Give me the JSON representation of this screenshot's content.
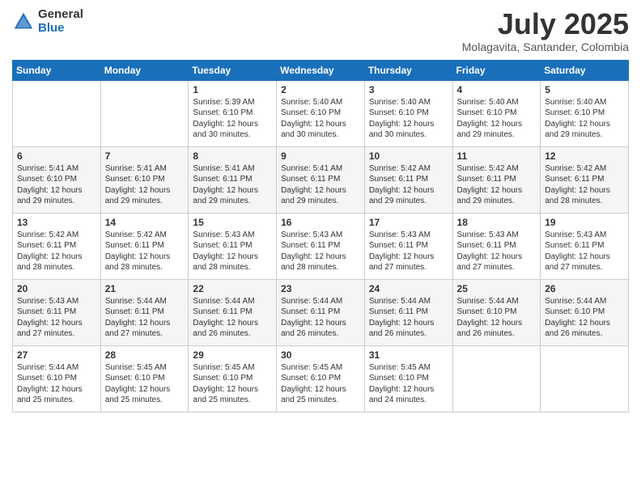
{
  "logo": {
    "general": "General",
    "blue": "Blue"
  },
  "title": "July 2025",
  "location": "Molagavita, Santander, Colombia",
  "days_of_week": [
    "Sunday",
    "Monday",
    "Tuesday",
    "Wednesday",
    "Thursday",
    "Friday",
    "Saturday"
  ],
  "weeks": [
    [
      {
        "day": "",
        "info": ""
      },
      {
        "day": "",
        "info": ""
      },
      {
        "day": "1",
        "info": "Sunrise: 5:39 AM\nSunset: 6:10 PM\nDaylight: 12 hours and 30 minutes."
      },
      {
        "day": "2",
        "info": "Sunrise: 5:40 AM\nSunset: 6:10 PM\nDaylight: 12 hours and 30 minutes."
      },
      {
        "day": "3",
        "info": "Sunrise: 5:40 AM\nSunset: 6:10 PM\nDaylight: 12 hours and 30 minutes."
      },
      {
        "day": "4",
        "info": "Sunrise: 5:40 AM\nSunset: 6:10 PM\nDaylight: 12 hours and 29 minutes."
      },
      {
        "day": "5",
        "info": "Sunrise: 5:40 AM\nSunset: 6:10 PM\nDaylight: 12 hours and 29 minutes."
      }
    ],
    [
      {
        "day": "6",
        "info": "Sunrise: 5:41 AM\nSunset: 6:10 PM\nDaylight: 12 hours and 29 minutes."
      },
      {
        "day": "7",
        "info": "Sunrise: 5:41 AM\nSunset: 6:10 PM\nDaylight: 12 hours and 29 minutes."
      },
      {
        "day": "8",
        "info": "Sunrise: 5:41 AM\nSunset: 6:11 PM\nDaylight: 12 hours and 29 minutes."
      },
      {
        "day": "9",
        "info": "Sunrise: 5:41 AM\nSunset: 6:11 PM\nDaylight: 12 hours and 29 minutes."
      },
      {
        "day": "10",
        "info": "Sunrise: 5:42 AM\nSunset: 6:11 PM\nDaylight: 12 hours and 29 minutes."
      },
      {
        "day": "11",
        "info": "Sunrise: 5:42 AM\nSunset: 6:11 PM\nDaylight: 12 hours and 29 minutes."
      },
      {
        "day": "12",
        "info": "Sunrise: 5:42 AM\nSunset: 6:11 PM\nDaylight: 12 hours and 28 minutes."
      }
    ],
    [
      {
        "day": "13",
        "info": "Sunrise: 5:42 AM\nSunset: 6:11 PM\nDaylight: 12 hours and 28 minutes."
      },
      {
        "day": "14",
        "info": "Sunrise: 5:42 AM\nSunset: 6:11 PM\nDaylight: 12 hours and 28 minutes."
      },
      {
        "day": "15",
        "info": "Sunrise: 5:43 AM\nSunset: 6:11 PM\nDaylight: 12 hours and 28 minutes."
      },
      {
        "day": "16",
        "info": "Sunrise: 5:43 AM\nSunset: 6:11 PM\nDaylight: 12 hours and 28 minutes."
      },
      {
        "day": "17",
        "info": "Sunrise: 5:43 AM\nSunset: 6:11 PM\nDaylight: 12 hours and 27 minutes."
      },
      {
        "day": "18",
        "info": "Sunrise: 5:43 AM\nSunset: 6:11 PM\nDaylight: 12 hours and 27 minutes."
      },
      {
        "day": "19",
        "info": "Sunrise: 5:43 AM\nSunset: 6:11 PM\nDaylight: 12 hours and 27 minutes."
      }
    ],
    [
      {
        "day": "20",
        "info": "Sunrise: 5:43 AM\nSunset: 6:11 PM\nDaylight: 12 hours and 27 minutes."
      },
      {
        "day": "21",
        "info": "Sunrise: 5:44 AM\nSunset: 6:11 PM\nDaylight: 12 hours and 27 minutes."
      },
      {
        "day": "22",
        "info": "Sunrise: 5:44 AM\nSunset: 6:11 PM\nDaylight: 12 hours and 26 minutes."
      },
      {
        "day": "23",
        "info": "Sunrise: 5:44 AM\nSunset: 6:11 PM\nDaylight: 12 hours and 26 minutes."
      },
      {
        "day": "24",
        "info": "Sunrise: 5:44 AM\nSunset: 6:11 PM\nDaylight: 12 hours and 26 minutes."
      },
      {
        "day": "25",
        "info": "Sunrise: 5:44 AM\nSunset: 6:10 PM\nDaylight: 12 hours and 26 minutes."
      },
      {
        "day": "26",
        "info": "Sunrise: 5:44 AM\nSunset: 6:10 PM\nDaylight: 12 hours and 26 minutes."
      }
    ],
    [
      {
        "day": "27",
        "info": "Sunrise: 5:44 AM\nSunset: 6:10 PM\nDaylight: 12 hours and 25 minutes."
      },
      {
        "day": "28",
        "info": "Sunrise: 5:45 AM\nSunset: 6:10 PM\nDaylight: 12 hours and 25 minutes."
      },
      {
        "day": "29",
        "info": "Sunrise: 5:45 AM\nSunset: 6:10 PM\nDaylight: 12 hours and 25 minutes."
      },
      {
        "day": "30",
        "info": "Sunrise: 5:45 AM\nSunset: 6:10 PM\nDaylight: 12 hours and 25 minutes."
      },
      {
        "day": "31",
        "info": "Sunrise: 5:45 AM\nSunset: 6:10 PM\nDaylight: 12 hours and 24 minutes."
      },
      {
        "day": "",
        "info": ""
      },
      {
        "day": "",
        "info": ""
      }
    ]
  ]
}
